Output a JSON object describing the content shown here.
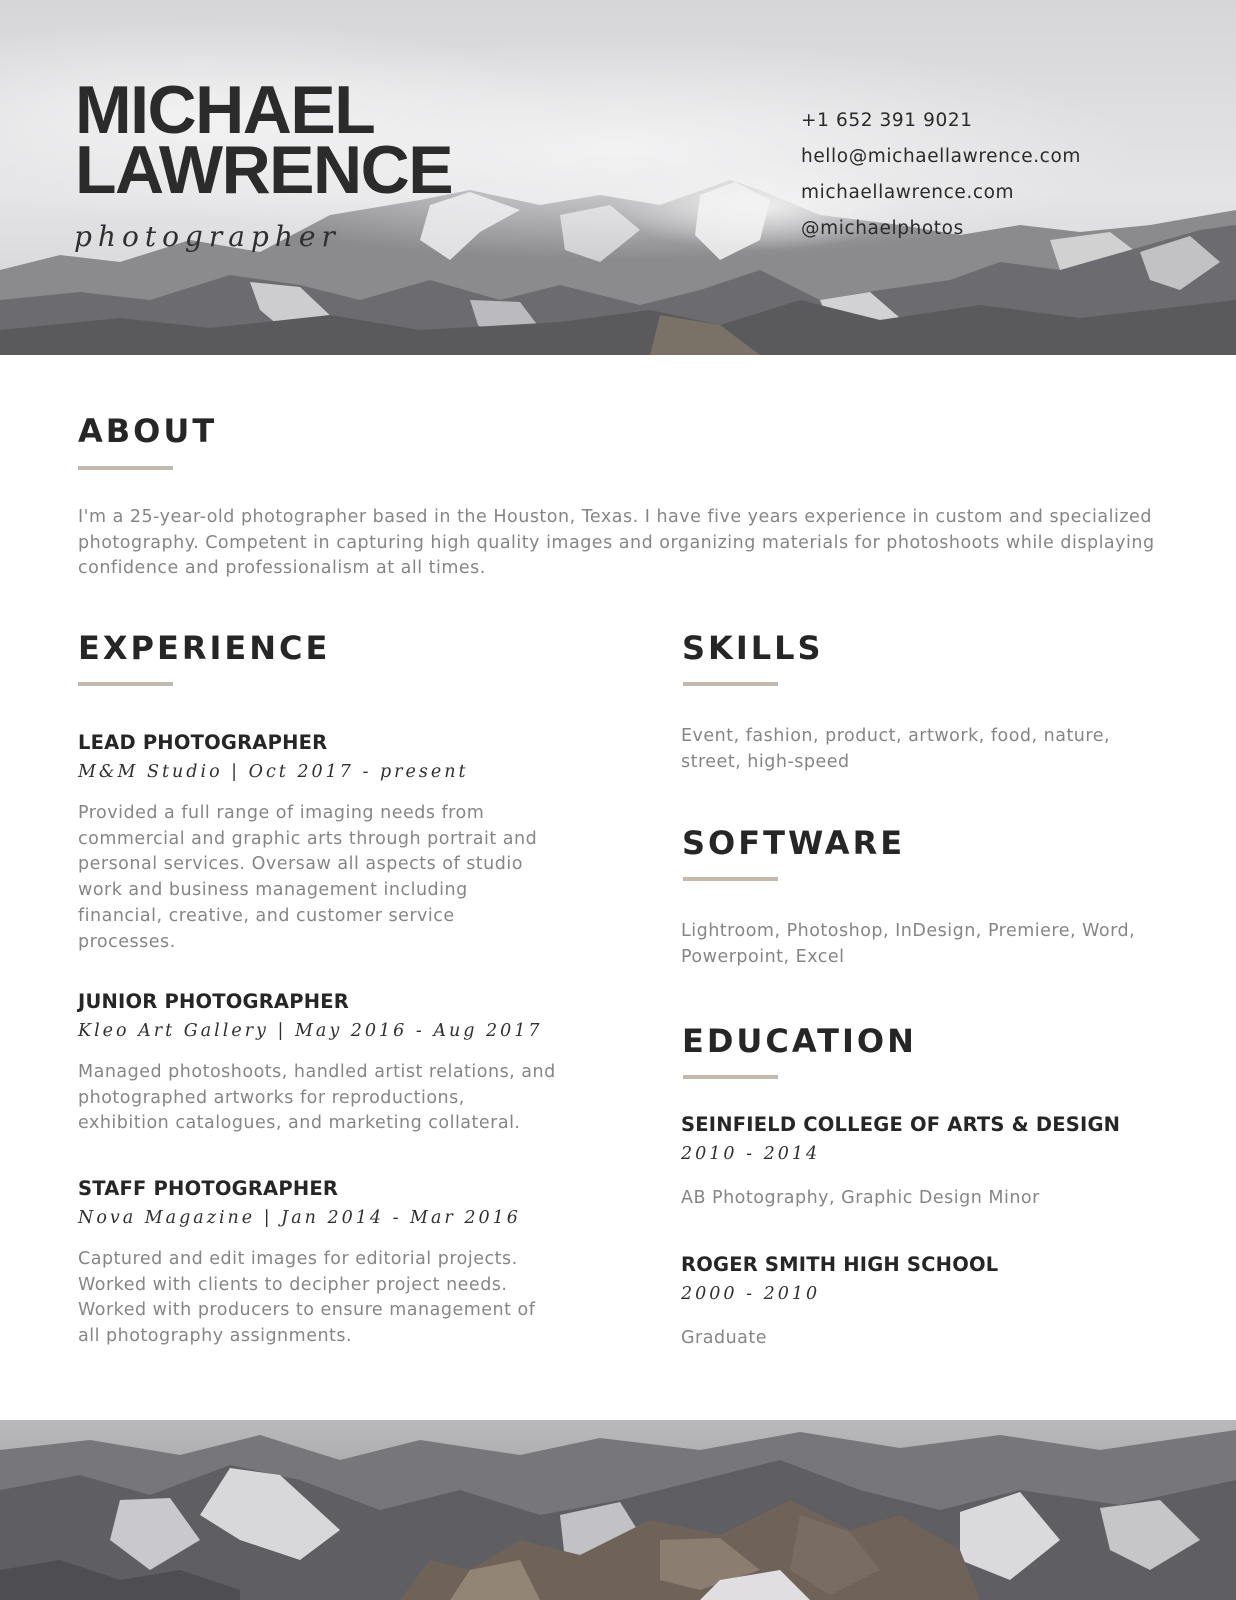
{
  "header": {
    "name_line1": "MICHAEL",
    "name_line2": "LAWRENCE",
    "role": "photographer",
    "contact": {
      "phone": "+1 652 391 9021",
      "email": "hello@michaellawrence.com",
      "website": "michaellawrence.com",
      "social": "@michaelphotos"
    }
  },
  "about": {
    "heading": "ABOUT",
    "text": "I'm a 25-year-old photographer based in the Houston, Texas. I have five years experience in custom and specialized photography. Competent in capturing high quality images and organizing materials for photoshoots while displaying confidence and professionalism at all times."
  },
  "experience": {
    "heading": "EXPERIENCE",
    "jobs": [
      {
        "title": "LEAD PHOTOGRAPHER",
        "meta": "M&M Studio | Oct 2017 - present",
        "description": "Provided a full range of imaging needs from commercial and graphic arts through portrait and personal services. Oversaw all aspects of studio work and business management including financial, creative, and customer service processes."
      },
      {
        "title": "JUNIOR PHOTOGRAPHER",
        "meta": "Kleo Art Gallery | May 2016 - Aug 2017",
        "description": "Managed photoshoots, handled artist relations, and photographed artworks for reproductions, exhibition catalogues, and marketing collateral."
      },
      {
        "title": "STAFF PHOTOGRAPHER",
        "meta": "Nova Magazine | Jan 2014 - Mar 2016",
        "description": "Captured and edit images for editorial projects. Worked with clients to decipher project needs. Worked with producers to ensure management of all photography assignments."
      }
    ]
  },
  "skills": {
    "heading": "SKILLS",
    "text": "Event, fashion, product, artwork, food, nature, street, high-speed"
  },
  "software": {
    "heading": "SOFTWARE",
    "text": "Lightroom, Photoshop, InDesign, Premiere, Word, Powerpoint, Excel"
  },
  "education": {
    "heading": "EDUCATION",
    "schools": [
      {
        "name": "SEINFIELD COLLEGE OF ARTS & DESIGN",
        "years": "2010 - 2014",
        "detail": "AB Photography, Graphic Design Minor"
      },
      {
        "name": "ROGER SMITH HIGH SCHOOL",
        "years": "2000 - 2010",
        "detail": "Graduate"
      }
    ]
  },
  "colors": {
    "accent_rule": "#c4b9ad",
    "heading_text": "#262626",
    "body_text": "#868686"
  }
}
